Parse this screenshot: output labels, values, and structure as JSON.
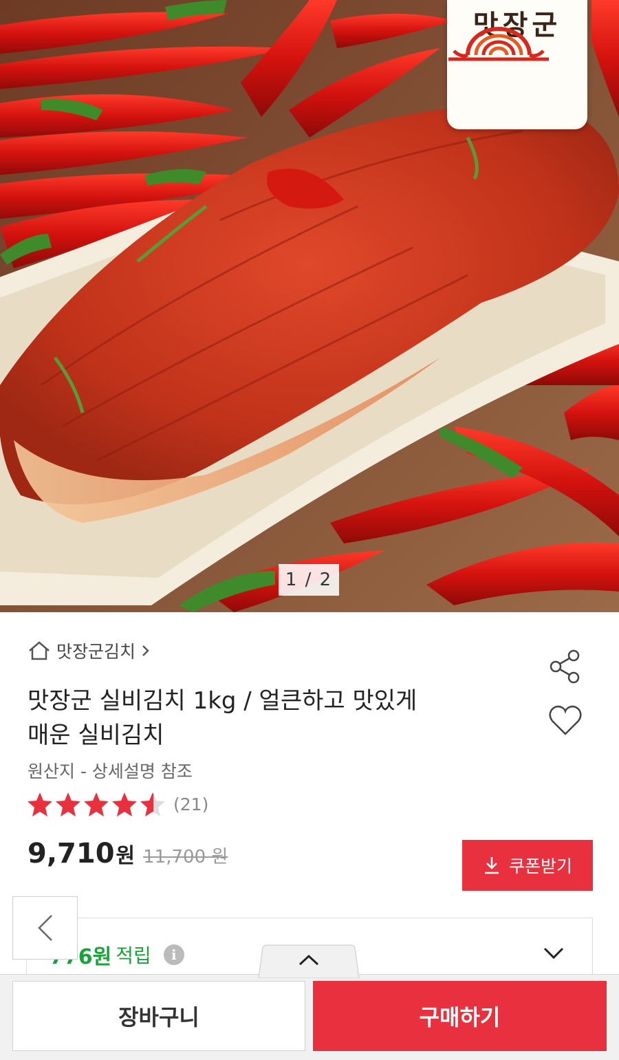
{
  "brand": {
    "logo_text": "맛장군"
  },
  "gallery": {
    "pager": "1 / 2"
  },
  "breadcrumb": {
    "store": "맛장군김치"
  },
  "product": {
    "title_line1": "맛장군 실비김치 1kg / 얼큰하고 맛있게",
    "title_line2": "매운 실비김치",
    "origin": "원산지 - 상세설명 참조",
    "rating": 4.5,
    "review_count": "(21)",
    "price": "9,710",
    "price_unit": "원",
    "original_price": "11,700 원"
  },
  "coupon": {
    "label": "쿠폰받기"
  },
  "points": {
    "amount": "776원",
    "label": "적립",
    "info": "i"
  },
  "actions": {
    "cart": "장바구니",
    "buy": "구매하기"
  },
  "colors": {
    "accent": "#e8303e",
    "points_green": "#1aa33a",
    "star": "#e8303e"
  }
}
